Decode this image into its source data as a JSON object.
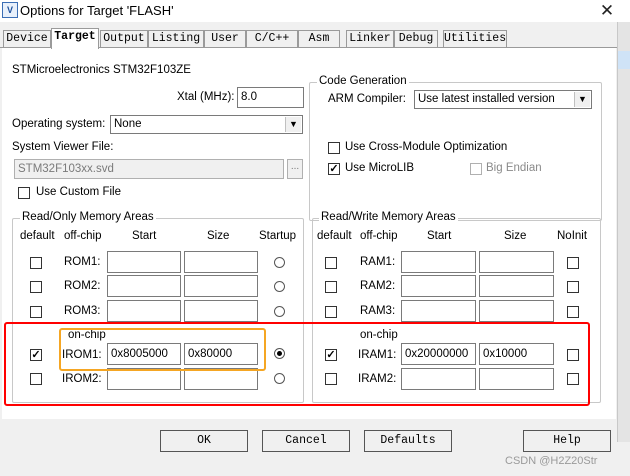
{
  "window": {
    "title": "Options for Target 'FLASH'",
    "app_icon": "V",
    "close_glyph": "✕"
  },
  "tabs": [
    {
      "label": "Device",
      "active": false
    },
    {
      "label": "Target",
      "active": true
    },
    {
      "label": "Output",
      "active": false
    },
    {
      "label": "Listing",
      "active": false
    },
    {
      "label": "User",
      "active": false
    },
    {
      "label": "C/C++",
      "active": false
    },
    {
      "label": "Asm",
      "active": false
    },
    {
      "label": "Linker",
      "active": false
    },
    {
      "label": "Debug",
      "active": false
    },
    {
      "label": "Utilities",
      "active": false
    }
  ],
  "target": {
    "device_name": "STMicroelectronics STM32F103ZE",
    "xtal_label": "Xtal (MHz):",
    "xtal_value": "8.0",
    "os_label": "Operating system:",
    "os_value": "None",
    "svd_label": "System Viewer File:",
    "svd_value": "STM32F103xx.svd",
    "svd_browse": "...",
    "custom_file_label": "Use Custom File",
    "custom_file_checked": false
  },
  "code_generation": {
    "title": "Code Generation",
    "compiler_label": "ARM Compiler:",
    "compiler_value": "Use latest installed version",
    "cross_module_label": "Use Cross-Module Optimization",
    "cross_module_checked": false,
    "microlib_label": "Use MicroLIB",
    "microlib_checked": true,
    "big_endian_label": "Big Endian",
    "big_endian_checked": false
  },
  "ro_memory": {
    "title": "Read/Only Memory Areas",
    "headers": {
      "default": "default",
      "offchip": "off-chip",
      "start": "Start",
      "size": "Size",
      "startup": "Startup"
    },
    "onchip_label": "on-chip",
    "offchip_rows": [
      {
        "name": "ROM1:",
        "default": false,
        "start": "",
        "size": "",
        "startup": false
      },
      {
        "name": "ROM2:",
        "default": false,
        "start": "",
        "size": "",
        "startup": false
      },
      {
        "name": "ROM3:",
        "default": false,
        "start": "",
        "size": "",
        "startup": false
      }
    ],
    "onchip_rows": [
      {
        "name": "IROM1:",
        "default": true,
        "start": "0x8005000",
        "size": "0x80000",
        "startup": true
      },
      {
        "name": "IROM2:",
        "default": false,
        "start": "",
        "size": "",
        "startup": false
      }
    ]
  },
  "rw_memory": {
    "title": "Read/Write Memory Areas",
    "headers": {
      "default": "default",
      "offchip": "off-chip",
      "start": "Start",
      "size": "Size",
      "noinit": "NoInit"
    },
    "onchip_label": "on-chip",
    "offchip_rows": [
      {
        "name": "RAM1:",
        "default": false,
        "start": "",
        "size": "",
        "noinit": false
      },
      {
        "name": "RAM2:",
        "default": false,
        "start": "",
        "size": "",
        "noinit": false
      },
      {
        "name": "RAM3:",
        "default": false,
        "start": "",
        "size": "",
        "noinit": false
      }
    ],
    "onchip_rows": [
      {
        "name": "IRAM1:",
        "default": true,
        "start": "0x20000000",
        "size": "0x10000",
        "noinit": false
      },
      {
        "name": "IRAM2:",
        "default": false,
        "start": "",
        "size": "",
        "noinit": false
      }
    ]
  },
  "buttons": {
    "ok": "OK",
    "cancel": "Cancel",
    "defaults": "Defaults",
    "help": "Help"
  },
  "watermark": "CSDN @H2Z20Str",
  "annotation_colors": {
    "red": "#ff0000",
    "orange": "#f5a623"
  }
}
